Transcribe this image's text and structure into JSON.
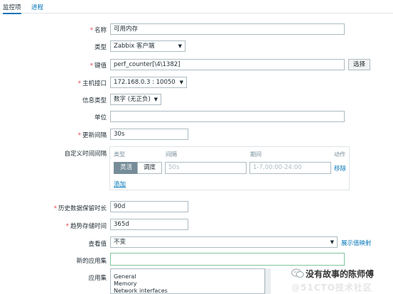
{
  "tabs": [
    {
      "label": "监控项",
      "active": true
    },
    {
      "label": "进程",
      "active": false
    }
  ],
  "form": {
    "name": {
      "label": "名称",
      "value": "可用内存"
    },
    "type": {
      "label": "类型",
      "value": "Zabbix 客户端"
    },
    "key": {
      "label": "键值",
      "value": "perf_counter[\\4\\1382]",
      "button": "选择"
    },
    "host_interface": {
      "label": "主机接口",
      "value": "172.168.0.3 : 10050"
    },
    "info_type": {
      "label": "信息类型",
      "value": "数字 (无正负)"
    },
    "units": {
      "label": "单位",
      "value": ""
    },
    "update_interval": {
      "label": "更新间隔",
      "value": "30s"
    },
    "custom_intervals": {
      "label": "自定义时间间隔",
      "headers": {
        "type": "类型",
        "interval": "间隔",
        "period": "期间",
        "action": "动作"
      },
      "row": {
        "type_flexible": "灵活",
        "type_scheduling": "调度",
        "interval": "50s",
        "period": "1-7,00:00-24:00",
        "remove": "移除"
      },
      "add": "添加"
    },
    "history": {
      "label": "历史数据保留时长",
      "value": "90d"
    },
    "trends": {
      "label": "趋势存储时间",
      "value": "365d"
    },
    "show_value": {
      "label": "查看值",
      "value": "不变",
      "link": "展示值映射"
    },
    "new_application": {
      "label": "新的应用集",
      "value": ""
    },
    "applications": {
      "label": "应用集",
      "items": [
        "General",
        "Memory",
        "Network interfaces"
      ]
    }
  },
  "watermark": {
    "line1": "没有故事的陈师傅",
    "line2": "@51CTO技术社区"
  }
}
